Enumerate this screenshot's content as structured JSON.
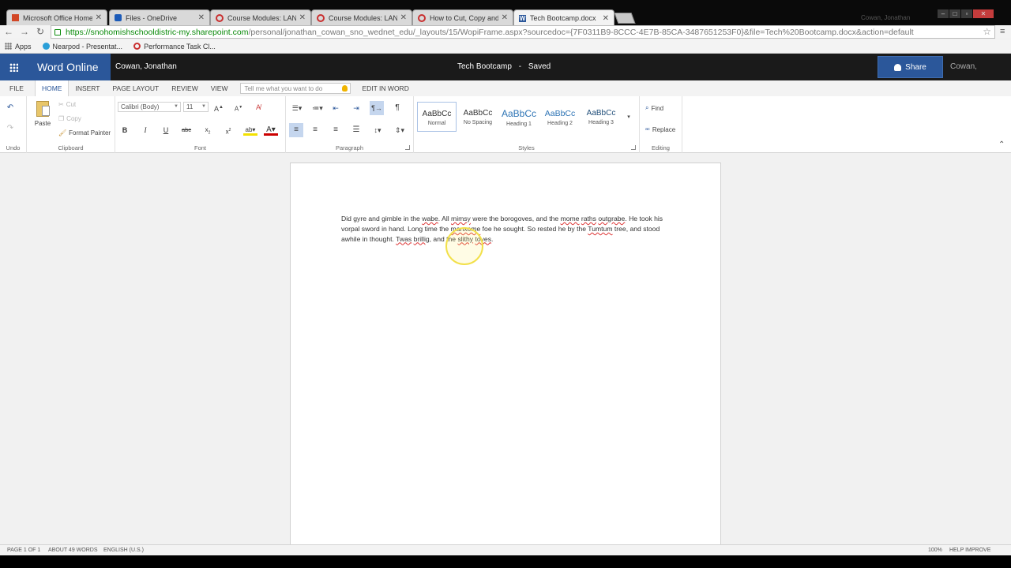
{
  "browser": {
    "tabs": [
      {
        "label": "Microsoft Office Home",
        "icon": "office-icon"
      },
      {
        "label": "Files - OneDrive",
        "icon": "onedrive-icon"
      },
      {
        "label": "Course Modules: LANGUA",
        "icon": "canvas-icon"
      },
      {
        "label": "Course Modules: LANGUA",
        "icon": "canvas-icon"
      },
      {
        "label": "How to Cut, Copy and Pa",
        "icon": "canvas-icon"
      },
      {
        "label": "Tech Bootcamp.docx",
        "icon": "word-icon"
      }
    ],
    "url_scheme": "https://",
    "url_host": "snohomishschooldistric-my.sharepoint.com",
    "url_path": "/personal/jonathan_cowan_sno_wednet_edu/_layouts/15/WopiFrame.aspx?sourcedoc={7F0311B9-8CCC-4E7B-85CA-3487651253F0}&file=Tech%20Bootcamp.docx&action=default",
    "bookmarks": {
      "apps": "Apps",
      "nearpod": "Nearpod - Presentat...",
      "performance": "Performance Task Cl..."
    }
  },
  "app": {
    "brand": "Word Online",
    "user": "Cowan, Jonathan",
    "doc_title": "Tech Bootcamp",
    "separator": "-",
    "save_status": "Saved",
    "share_label": "Share",
    "user_right": "Cowan, Jonathan"
  },
  "ribbon_tabs": {
    "file": "FILE",
    "home": "HOME",
    "insert": "INSERT",
    "page_layout": "PAGE LAYOUT",
    "review": "REVIEW",
    "view": "VIEW",
    "tell_me_placeholder": "Tell me what you want to do",
    "edit_in_word": "EDIT IN WORD"
  },
  "ribbon": {
    "undo_group": "Undo",
    "paste": "Paste",
    "cut": "Cut",
    "copy": "Copy",
    "format_painter": "Format Painter",
    "clipboard_group": "Clipboard",
    "font_name": "Calibri (Body)",
    "font_size": "11",
    "font_group": "Font",
    "paragraph_group": "Paragraph",
    "styles": [
      {
        "sample": "AaBbCc",
        "name": "Normal"
      },
      {
        "sample": "AaBbCc",
        "name": "No Spacing"
      },
      {
        "sample": "AaBbCc",
        "name": "Heading 1"
      },
      {
        "sample": "AaBbCc",
        "name": "Heading 2"
      },
      {
        "sample": "AaBbCc",
        "name": "Heading 3"
      }
    ],
    "styles_group": "Styles",
    "find": "Find",
    "replace": "Replace",
    "editing_group": "Editing"
  },
  "document": {
    "paragraph": [
      {
        "t": "Did gyre and gimble in the ",
        "sq": false
      },
      {
        "t": "wabe",
        "sq": true
      },
      {
        "t": ". All ",
        "sq": false
      },
      {
        "t": "mimsy",
        "sq": true
      },
      {
        "t": " were the borogoves, and the ",
        "sq": false
      },
      {
        "t": "mome",
        "sq": true
      },
      {
        "t": " ",
        "sq": false
      },
      {
        "t": "raths",
        "sq": true
      },
      {
        "t": " ",
        "sq": false
      },
      {
        "t": "outgrabe",
        "sq": true
      },
      {
        "t": ".  He took his vorpal sword in hand. Long time the ",
        "sq": false
      },
      {
        "t": "manxome",
        "sq": true
      },
      {
        "t": " foe he sought. So rested he by the ",
        "sq": false
      },
      {
        "t": "Tumtum",
        "sq": true
      },
      {
        "t": " tree, and stood awhile in thought. ",
        "sq": false
      },
      {
        "t": "Twas",
        "sq": true
      },
      {
        "t": " ",
        "sq": false
      },
      {
        "t": "brillig",
        "sq": true
      },
      {
        "t": ", and the ",
        "sq": false
      },
      {
        "t": "slithy",
        "sq": true
      },
      {
        "t": " ",
        "sq": false
      },
      {
        "t": "toves",
        "sq": true
      },
      {
        "t": ".",
        "sq": false
      }
    ]
  },
  "status": {
    "page": "PAGE 1 OF 1",
    "words": "ABOUT 49 WORDS",
    "language": "ENGLISH (U.S.)",
    "zoom": "100%",
    "help": "HELP IMPROVE OFFICE"
  },
  "colors": {
    "word_blue": "#2b579a",
    "spell_squiggle": "#dd3333",
    "cursor_highlight": "#f2e04a"
  }
}
